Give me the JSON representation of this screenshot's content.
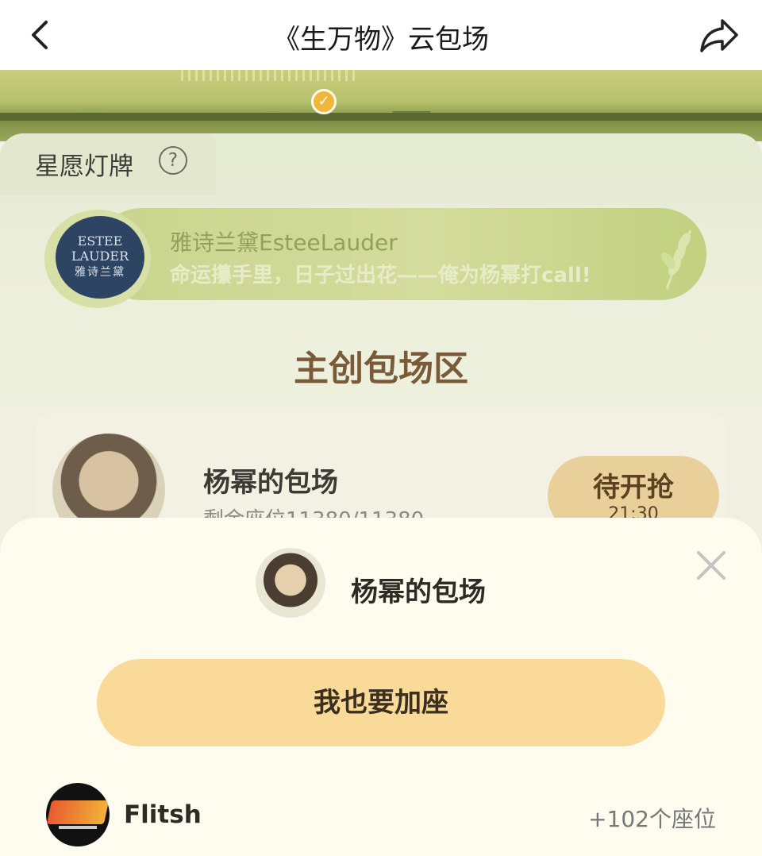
{
  "nav": {
    "title": "《生万物》云包场"
  },
  "wish_board": {
    "title": "星愿灯牌",
    "help_icon": "?"
  },
  "brand": {
    "logo_lines": [
      "ESTEE",
      "LAUDER",
      "雅诗兰黛"
    ],
    "name": "雅诗兰黛EsteeLauder",
    "slogan": "命运攥手里，日子过出花——俺为杨幂打call!"
  },
  "section": {
    "title": "主创包场区"
  },
  "host_card": {
    "name": "杨幂的包场",
    "seats": "剩余座位11380/11380",
    "button_label": "待开抢",
    "button_time": "21:30"
  },
  "sheet": {
    "title": "杨幂的包场",
    "verified_badge": "✓",
    "join_label": "我也要加座",
    "user": {
      "name": "Flitsh",
      "seats": "+102个座位"
    }
  },
  "colors": {
    "accent": "#f9da99",
    "badge": "#f2b63b",
    "sheet_bg": "#fdfcef"
  }
}
